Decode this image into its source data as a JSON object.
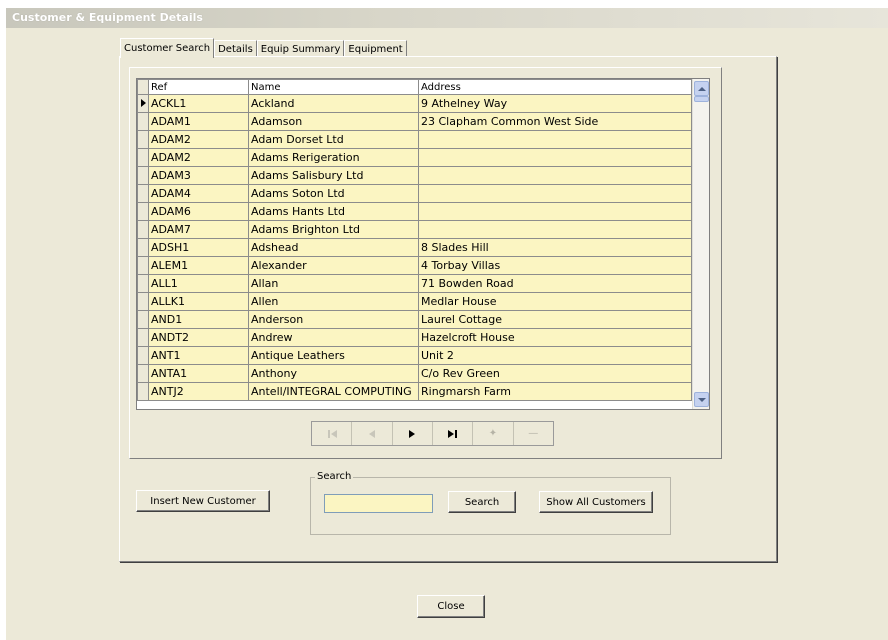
{
  "window": {
    "title": "Customer & Equipment Details"
  },
  "tabs": [
    {
      "label": "Customer Search",
      "active": true
    },
    {
      "label": "Details",
      "active": false
    },
    {
      "label": "Equip Summary",
      "active": false
    },
    {
      "label": "Equipment",
      "active": false
    }
  ],
  "grid": {
    "columns": [
      "Ref",
      "Name",
      "Address"
    ],
    "rows": [
      {
        "ref": "ACKL1",
        "name": "Ackland",
        "address": "9 Athelney Way",
        "current": true
      },
      {
        "ref": "ADAM1",
        "name": "Adamson",
        "address": "23 Clapham Common West Side"
      },
      {
        "ref": "ADAM2",
        "name": "Adam Dorset Ltd",
        "address": ""
      },
      {
        "ref": "ADAM2",
        "name": "Adams Rerigeration",
        "address": ""
      },
      {
        "ref": "ADAM3",
        "name": "Adams Salisbury Ltd",
        "address": ""
      },
      {
        "ref": "ADAM4",
        "name": "Adams Soton Ltd",
        "address": ""
      },
      {
        "ref": "ADAM6",
        "name": "Adams Hants Ltd",
        "address": ""
      },
      {
        "ref": "ADAM7",
        "name": "Adams Brighton Ltd",
        "address": ""
      },
      {
        "ref": "ADSH1",
        "name": "Adshead",
        "address": "8 Slades Hill"
      },
      {
        "ref": "ALEM1",
        "name": "Alexander",
        "address": "4 Torbay Villas"
      },
      {
        "ref": "ALL1",
        "name": "Allan",
        "address": "71 Bowden Road"
      },
      {
        "ref": "ALLK1",
        "name": "Allen",
        "address": "Medlar House"
      },
      {
        "ref": "AND1",
        "name": "Anderson",
        "address": "Laurel Cottage"
      },
      {
        "ref": "ANDT2",
        "name": "Andrew",
        "address": "Hazelcroft House"
      },
      {
        "ref": "ANT1",
        "name": "Antique Leathers",
        "address": "Unit 2"
      },
      {
        "ref": "ANTA1",
        "name": "Anthony",
        "address": "C/o Rev Green"
      },
      {
        "ref": "ANTJ2",
        "name": "Antell/INTEGRAL COMPUTING",
        "address": "Ringmarsh Farm"
      }
    ]
  },
  "navigator": {
    "buttons": [
      {
        "name": "first-record",
        "icon": "first-icon",
        "enabled": false
      },
      {
        "name": "prior-record",
        "icon": "prior-icon",
        "enabled": false
      },
      {
        "name": "next-record",
        "icon": "next-icon",
        "enabled": true
      },
      {
        "name": "last-record",
        "icon": "last-icon",
        "enabled": true
      },
      {
        "name": "insert-record",
        "icon": "plus-icon",
        "enabled": false
      },
      {
        "name": "delete-record",
        "icon": "minus-icon",
        "enabled": false
      }
    ]
  },
  "actions": {
    "insert_label": "Insert New Customer",
    "close_label": "Close"
  },
  "search": {
    "group_label": "Search",
    "value": "",
    "button_label": "Search",
    "show_all_label": "Show All Customers"
  },
  "colors": {
    "face": "#ece9d8",
    "row_fill": "#fbf5c2",
    "scroll_button": "#c5d2f0"
  }
}
